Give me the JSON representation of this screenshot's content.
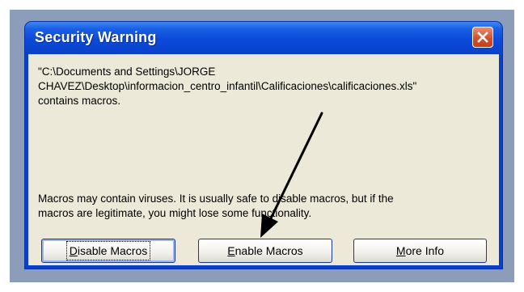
{
  "dialog": {
    "title": "Security Warning",
    "message_path_lines": [
      "\"C:\\Documents and Settings\\JORGE",
      "CHAVEZ\\Desktop\\informacion_centro_infantil\\Calificaciones\\calificaciones.xls\"",
      "contains macros."
    ],
    "message_warning_lines": [
      "Macros may contain viruses. It is usually safe to disable macros, but if the",
      "macros are legitimate, you might lose some functionality."
    ]
  },
  "buttons": {
    "disable": {
      "access_key": "D",
      "rest": "isable Macros"
    },
    "enable": {
      "access_key": "E",
      "rest": "nable Macros"
    },
    "more_info": {
      "access_key": "M",
      "rest": "ore Info"
    }
  },
  "icons": {
    "close": "close-icon",
    "annotation": "arrow-annotation"
  },
  "colors": {
    "titlebar": "#0b4ad9",
    "close_button": "#d5502c",
    "client": "#ece9d8",
    "arrow": "#000000"
  }
}
